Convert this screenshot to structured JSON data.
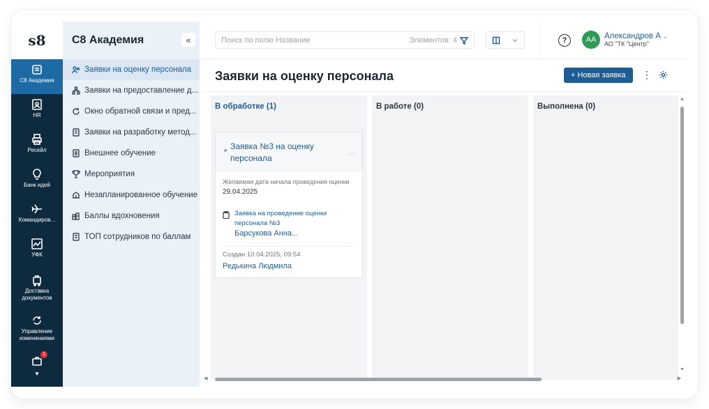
{
  "app": {
    "logo": "s8",
    "section_title": "С8 Академия"
  },
  "rail": {
    "items": [
      {
        "label": "С8 Академия",
        "icon": "inbox-icon",
        "active": true
      },
      {
        "label": "HR",
        "icon": "id-card-icon",
        "active": false
      },
      {
        "label": "Ресейл",
        "icon": "printer-icon",
        "active": false
      },
      {
        "label": "Банк идей",
        "icon": "idea-icon",
        "active": false
      },
      {
        "label": "Командиров...",
        "icon": "airplane-icon",
        "active": false
      },
      {
        "label": "УФК",
        "icon": "chart-board-icon",
        "active": false
      },
      {
        "label": "Доставка документов",
        "icon": "delivery-icon",
        "active": false
      },
      {
        "label": "Управление изменениями",
        "icon": "refresh-icon",
        "active": false
      }
    ],
    "badge": "1"
  },
  "nav": {
    "collapse": "«",
    "items": [
      {
        "label": "Заявки на оценку персонала",
        "icon": "people-icon",
        "active": true
      },
      {
        "label": "Заявки на предоставление д...",
        "icon": "hierarchy-icon",
        "active": false
      },
      {
        "label": "Окно обратной связи и пред...",
        "icon": "feedback-icon",
        "active": false
      },
      {
        "label": "Заявки на разработку метод...",
        "icon": "document-icon",
        "active": false
      },
      {
        "label": "Внешнее обучение",
        "icon": "book-icon",
        "active": false
      },
      {
        "label": "Мероприятия",
        "icon": "trophy-icon",
        "active": false
      },
      {
        "label": "Незапланированное обучение",
        "icon": "library-icon",
        "active": false
      },
      {
        "label": "Баллы вдохновения",
        "icon": "coins-icon",
        "active": false
      },
      {
        "label": "ТОП сотрудников по баллам",
        "icon": "list-icon",
        "active": false
      }
    ]
  },
  "topbar": {
    "search_placeholder": "Поиск по полю Название",
    "count_label": "Элементов: 4",
    "help": "?",
    "user_initials": "АА",
    "user_name": "Александров А",
    "user_org": "АО \"ТК \"Центр\""
  },
  "page": {
    "title": "Заявки на оценку персонала",
    "new_button": "+ Новая заявка",
    "more": "⋮"
  },
  "board": {
    "columns": [
      {
        "title": "В обработке (1)"
      },
      {
        "title": "В работе (0)"
      },
      {
        "title": "Выполнена (0)"
      }
    ],
    "card": {
      "title": "Заявка №3 на оценку персонала",
      "field_label": "Желаемая дата начала проведения оценки",
      "field_value": "29.04.2025",
      "link_title": "Заявка на проведение оценки персонала №3",
      "link_person": "Барсукова Анна...",
      "created": "Создан  10.04.2025, 09:54",
      "author": "Редькина Людмила"
    }
  },
  "colors": {
    "rail_bg": "#0e2a3f",
    "rail_active": "#1e6aa4",
    "accent": "#1e5d94",
    "nav_bg": "#eaf1f8",
    "avatar": "#2f9b57",
    "badge": "#e5333b"
  }
}
